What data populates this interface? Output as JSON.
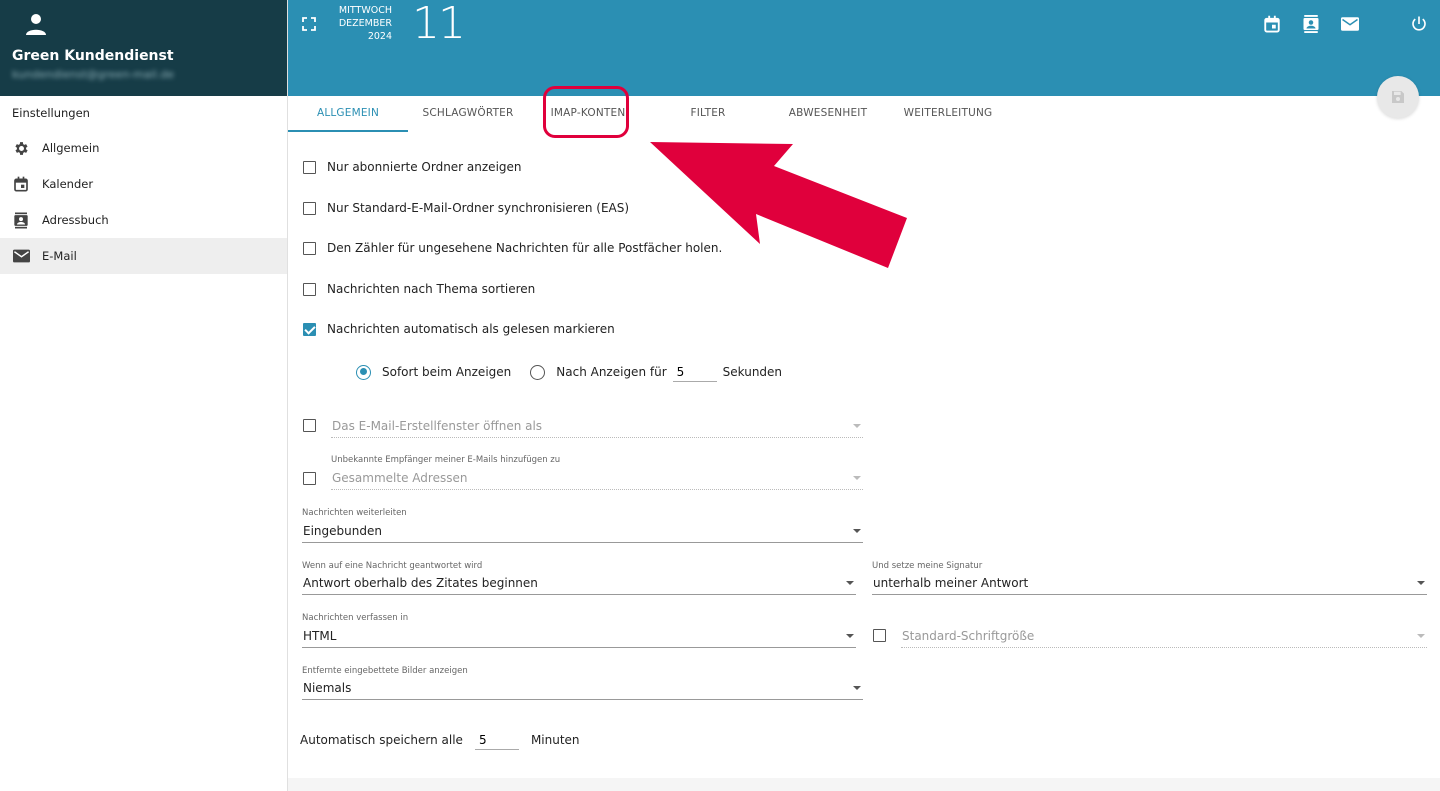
{
  "user": {
    "name": "Green Kundendienst",
    "email": "kundendienst@green-mail.de"
  },
  "sidebar": {
    "section_title": "Einstellungen",
    "items": [
      {
        "label": "Allgemein",
        "icon": "gear-icon"
      },
      {
        "label": "Kalender",
        "icon": "calendar-icon"
      },
      {
        "label": "Adressbuch",
        "icon": "contacts-icon"
      },
      {
        "label": "E-Mail",
        "icon": "mail-icon",
        "active": true
      }
    ]
  },
  "header": {
    "weekday": "MITTWOCH",
    "month": "DEZEMBER",
    "year": "2024",
    "day": "11"
  },
  "tabs": [
    {
      "label": "ALLGEMEIN",
      "active": true
    },
    {
      "label": "SCHLAGWÖRTER"
    },
    {
      "label": "IMAP-KONTEN"
    },
    {
      "label": "FILTER"
    },
    {
      "label": "ABWESENHEIT"
    },
    {
      "label": "WEITERLEITUNG"
    }
  ],
  "options": {
    "subscribed_only": {
      "label": "Nur abonnierte Ordner anzeigen",
      "checked": false
    },
    "sync_standard": {
      "label": "Nur Standard-E-Mail-Ordner synchronisieren (EAS)",
      "checked": false
    },
    "unseen_counter": {
      "label": "Den Zähler für ungesehene Nachrichten für alle Postfächer holen.",
      "checked": false
    },
    "sort_thread": {
      "label": "Nachrichten nach Thema sortieren",
      "checked": false
    },
    "mark_read": {
      "label": "Nachrichten automatisch als gelesen markieren",
      "checked": true
    },
    "radio_immediate": "Sofort beim Anzeigen",
    "radio_after": "Nach Anzeigen für",
    "after_seconds": "5",
    "seconds_unit": "Sekunden"
  },
  "fields": {
    "compose_window": {
      "placeholder": "Das E-Mail-Erstellfenster öffnen als"
    },
    "unknown_recipients": {
      "label": "Unbekannte Empfänger meiner E-Mails hinzufügen zu",
      "value": "Gesammelte Adressen"
    },
    "forward": {
      "label": "Nachrichten weiterleiten",
      "value": "Eingebunden"
    },
    "reply": {
      "label": "Wenn auf eine Nachricht geantwortet wird",
      "value": "Antwort oberhalb des Zitates beginnen"
    },
    "signature": {
      "label": "Und setze meine Signatur",
      "value": "unterhalb meiner Antwort"
    },
    "compose_format": {
      "label": "Nachrichten verfassen in",
      "value": "HTML"
    },
    "font_size": {
      "placeholder": "Standard-Schriftgröße"
    },
    "remote_images": {
      "label": "Entfernte eingebettete Bilder anzeigen",
      "value": "Niemals"
    },
    "autosave_label": "Automatisch speichern alle",
    "autosave_value": "5",
    "autosave_unit": "Minuten"
  },
  "colors": {
    "accent": "#2b8fb3",
    "sidebar_header": "#163c47",
    "annotation": "#e0003c"
  }
}
